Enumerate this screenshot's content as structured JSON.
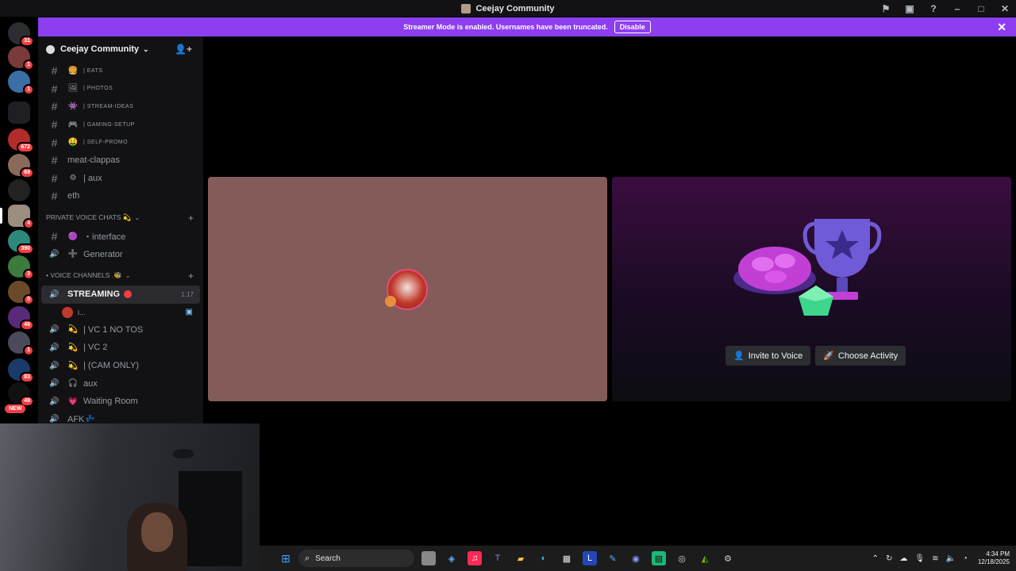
{
  "window": {
    "title": "Ceejay Community",
    "controls": [
      "inbox-icon",
      "monitor-icon",
      "help-icon",
      "minimize",
      "maximize",
      "close"
    ]
  },
  "banner": {
    "text": "Streamer Mode is enabled. Usernames have been truncated.",
    "button": "Disable"
  },
  "servers": [
    {
      "badge": "31"
    },
    {
      "badge": "1"
    },
    {
      "badge": "1"
    },
    {
      "badge": ""
    },
    {
      "badge": "672"
    },
    {
      "badge": "69"
    },
    {
      "badge": ""
    },
    {
      "badge": "4"
    },
    {
      "badge": "390"
    },
    {
      "badge": "3"
    },
    {
      "badge": "5"
    },
    {
      "badge": "46"
    },
    {
      "badge": "1"
    },
    {
      "badge": "83"
    },
    {
      "badge": "49"
    }
  ],
  "servers_new_label": "NEW",
  "guild": {
    "name": "Ceejay Community"
  },
  "channels_top": [
    {
      "emoji": "🍔",
      "name": "| eats",
      "style": "small"
    },
    {
      "emoji": "🖼",
      "name": "| photos",
      "style": "small"
    },
    {
      "emoji": "👾",
      "name": "| stream-ideas",
      "style": "small"
    },
    {
      "emoji": "🎮",
      "name": "| gaming-setup",
      "style": "small"
    },
    {
      "emoji": "🤑",
      "name": "| self-promo",
      "style": "small"
    },
    {
      "emoji": "",
      "name": "meat-clappas",
      "style": "normal"
    },
    {
      "emoji": "⚙",
      "name": "| aux",
      "style": "normal"
    },
    {
      "emoji": "",
      "name": "eth",
      "style": "normal"
    }
  ],
  "private_category": "PRIVATE VOICE CHATS 💫",
  "private_channels": [
    {
      "icon": "#",
      "emoji": "🟣",
      "name": "・interface"
    },
    {
      "icon": "🔊",
      "emoji": "➕",
      "name": "Generator"
    }
  ],
  "voice_category": "• VOICE CHANNELS .🐝",
  "voice_active": {
    "name": "STREAMING",
    "timer": "1:17",
    "user": "i..."
  },
  "voice_channels": [
    {
      "emoji": "💫",
      "name": "| VC 1 NO TOS"
    },
    {
      "emoji": "💫",
      "name": "| VC 2"
    },
    {
      "emoji": "💫",
      "name": "| (CAM ONLY)"
    },
    {
      "emoji": "🎧",
      "name": "aux"
    },
    {
      "emoji": "💗",
      "name": "Waiting Room"
    },
    {
      "emoji": "💤",
      "name": "AFK"
    }
  ],
  "activity": {
    "invite": "Invite to Voice",
    "choose": "Choose Activity"
  },
  "taskbar": {
    "search": "Search",
    "time": "4:34 PM",
    "date": "12/18/2025"
  }
}
